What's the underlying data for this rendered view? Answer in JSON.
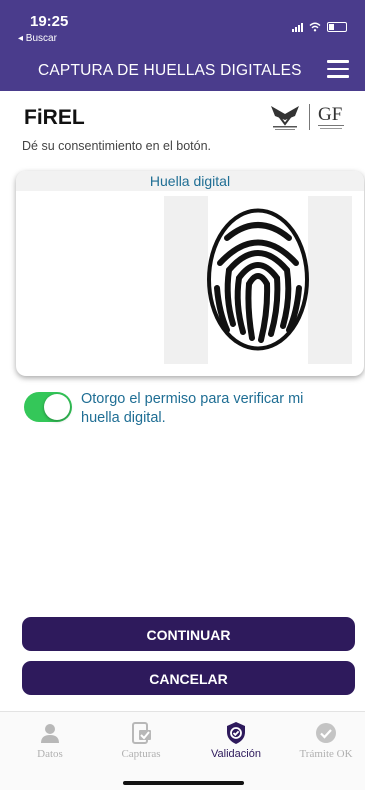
{
  "status_bar": {
    "time": "19:25",
    "back_label": "◂ Buscar"
  },
  "header": {
    "title": "CAPTURA DE HUELLAS DIGITALES"
  },
  "app": {
    "name": "FiREL",
    "subtitle": "Dé su consentimiento en el botón."
  },
  "logos": {
    "left": "SAT logo",
    "right": "GF logo",
    "right_text": "GF"
  },
  "card": {
    "title": "Huella digital"
  },
  "consent": {
    "text": "Otorgo el permiso para verificar mi huella digital.",
    "enabled": true
  },
  "buttons": {
    "continue": "CONTINUAR",
    "cancel": "CANCELAR"
  },
  "tabs": [
    {
      "label": "Datos",
      "icon": "person-icon",
      "active": false
    },
    {
      "label": "Capturas",
      "icon": "capture-icon",
      "active": false
    },
    {
      "label": "Validación",
      "icon": "shield-check-icon",
      "active": true
    },
    {
      "label": "Trámite OK",
      "icon": "check-circle-icon",
      "active": false
    }
  ],
  "colors": {
    "header": "#4a3c8c",
    "button": "#2e1a5c",
    "toggle_on": "#34c759",
    "link_text": "#1f6e94"
  }
}
